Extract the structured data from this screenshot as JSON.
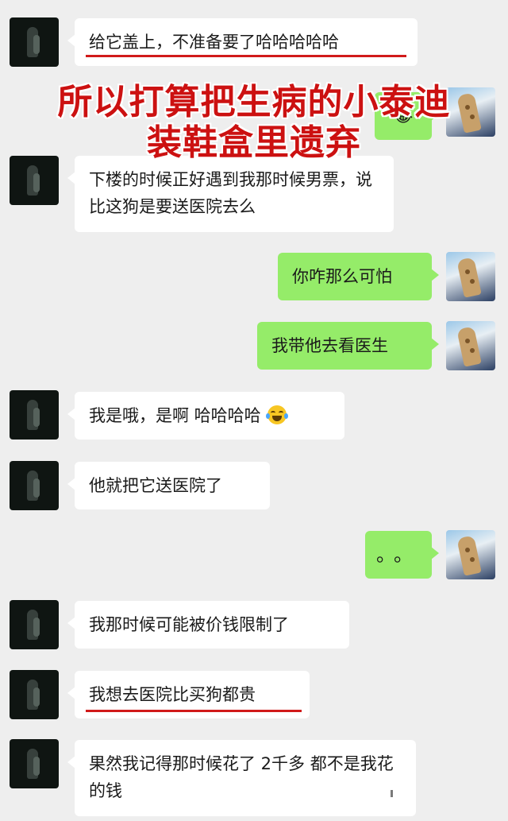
{
  "overlay": {
    "line1": "所以打算把生病的小泰迪",
    "line2": "装鞋盒里遗弃"
  },
  "messages": [
    {
      "side": "left",
      "text": "给它盖上，不准备要了哈哈哈哈哈"
    },
    {
      "side": "right",
      "text": "😂"
    },
    {
      "side": "left",
      "text": "下楼的时候正好遇到我那时候男票，说比这狗是要送医院去么"
    },
    {
      "side": "right",
      "text": "你咋那么可怕"
    },
    {
      "side": "right",
      "text": "我带他去看医生"
    },
    {
      "side": "left",
      "text": "我是哦，是啊 哈哈哈哈"
    },
    {
      "side": "left",
      "text": "他就把它送医院了"
    },
    {
      "side": "right",
      "text": "。。"
    },
    {
      "side": "left",
      "text": "我那时候可能被价钱限制了"
    },
    {
      "side": "left",
      "text": "我想去医院比买狗都贵"
    },
    {
      "side": "left",
      "text": "果然我记得那时候花了 2千多 都不是我花的钱"
    }
  ],
  "colors": {
    "overlay_red": "#cc1111",
    "underline_red": "#d11a1a",
    "bubble_green": "#95ec69",
    "bubble_white": "#ffffff",
    "background": "#eeeeee"
  }
}
